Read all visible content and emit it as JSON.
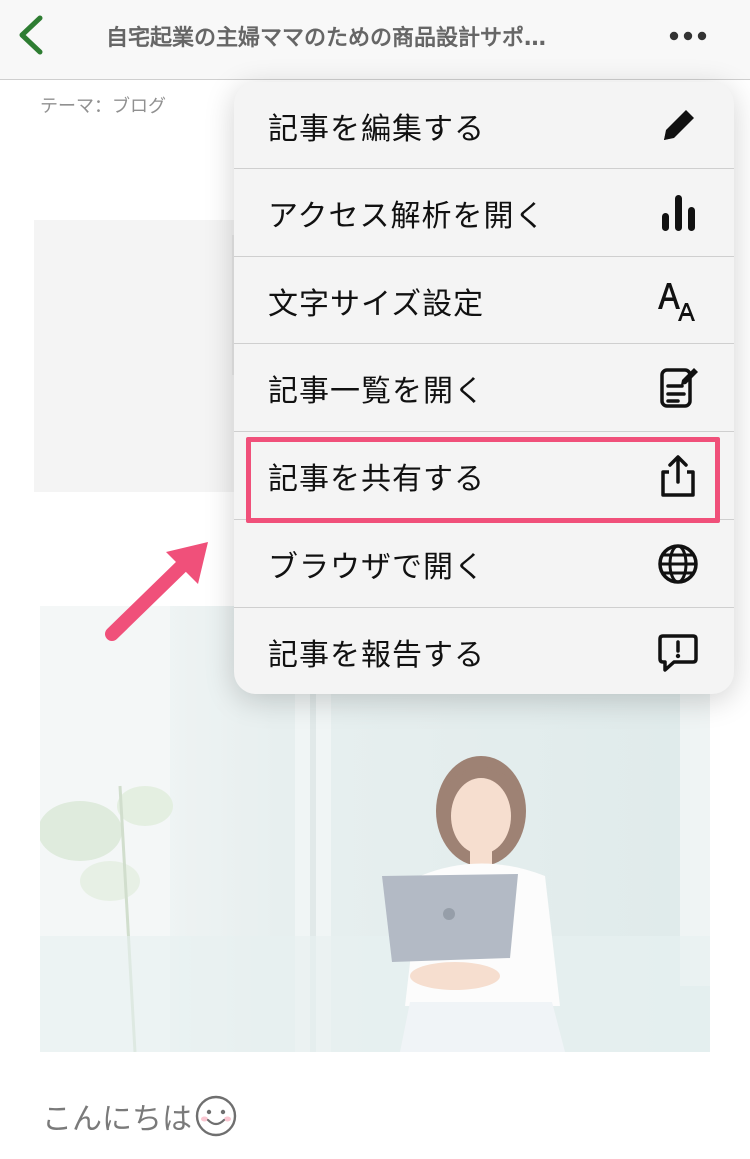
{
  "header": {
    "title": "自宅起業の主婦ママのための商品設計サポ…",
    "back_icon": "chevron-left-icon",
    "more_icon": "more-dots-icon",
    "accent_color": "#2e7d32"
  },
  "theme_label": "テーマ：ブログ",
  "menu": {
    "items": [
      {
        "label": "記事を編集する",
        "icon": "pencil-icon"
      },
      {
        "label": "アクセス解析を開く",
        "icon": "bar-chart-icon"
      },
      {
        "label": "文字サイズ設定",
        "icon": "font-size-icon"
      },
      {
        "label": "記事一覧を開く",
        "icon": "article-list-icon"
      },
      {
        "label": "記事を共有する",
        "icon": "share-icon"
      },
      {
        "label": "ブラウザで開く",
        "icon": "globe-icon"
      },
      {
        "label": "記事を報告する",
        "icon": "report-icon"
      }
    ],
    "highlight_color": "#f0507a"
  },
  "article": {
    "greeting": "こんにちは"
  }
}
